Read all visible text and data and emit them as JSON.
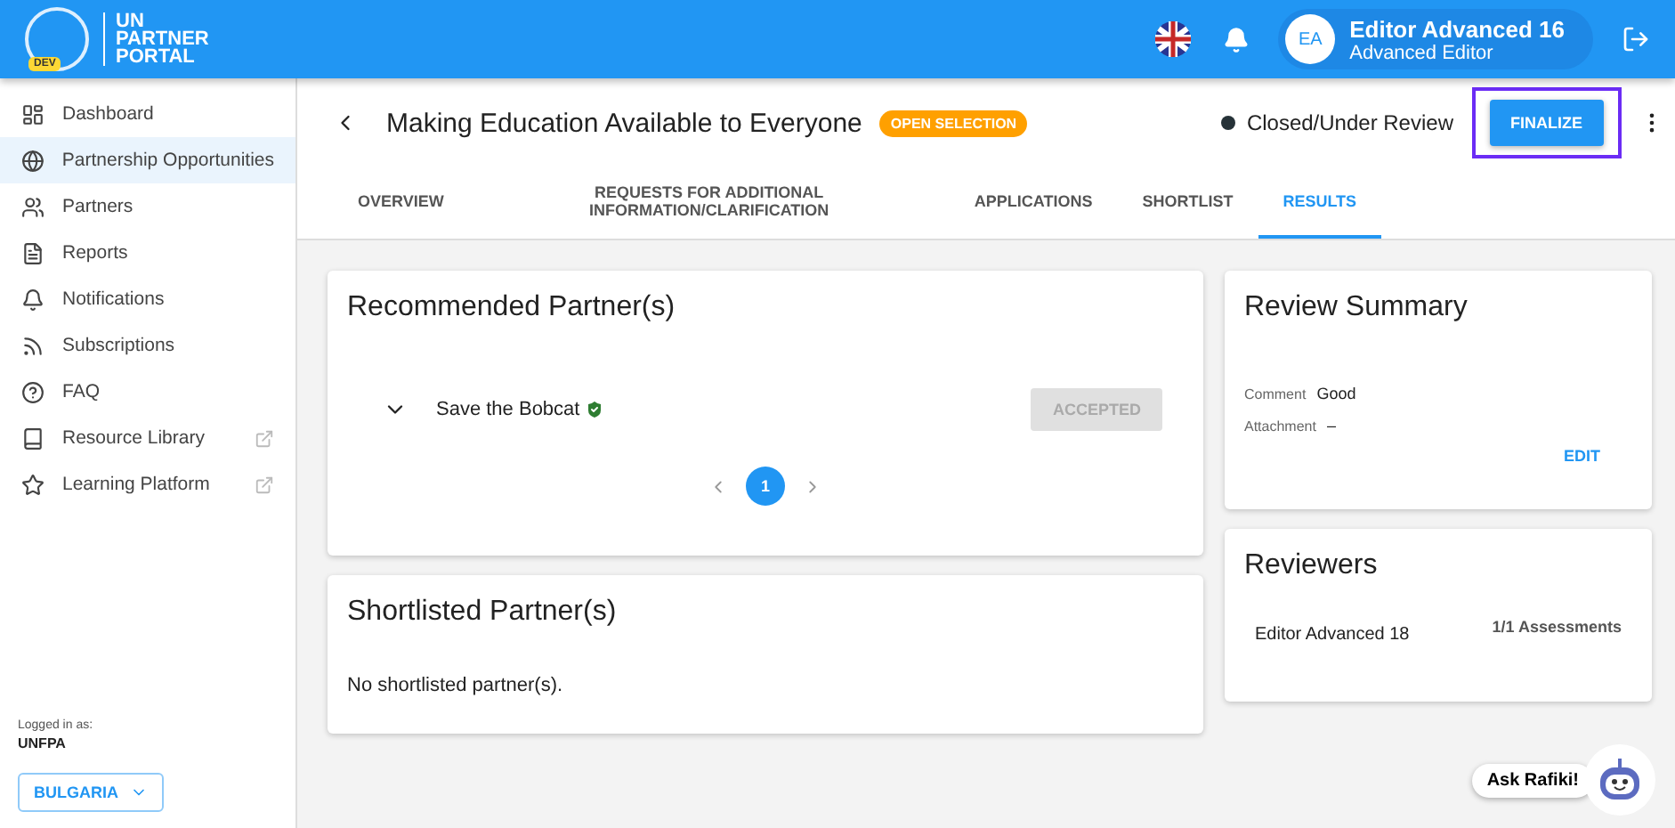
{
  "header": {
    "logo_badge": "DEV",
    "logo_text": [
      "UN",
      "PARTNER",
      "PORTAL"
    ],
    "user": {
      "initials": "EA",
      "name": "Editor Advanced 16",
      "role": "Advanced Editor"
    }
  },
  "sidebar": {
    "items": [
      {
        "label": "Dashboard",
        "external": false,
        "selected": false
      },
      {
        "label": "Partnership Opportunities",
        "external": false,
        "selected": true
      },
      {
        "label": "Partners",
        "external": false,
        "selected": false
      },
      {
        "label": "Reports",
        "external": false,
        "selected": false
      },
      {
        "label": "Notifications",
        "external": false,
        "selected": false
      },
      {
        "label": "Subscriptions",
        "external": false,
        "selected": false
      },
      {
        "label": "FAQ",
        "external": false,
        "selected": false
      },
      {
        "label": "Resource Library",
        "external": true,
        "selected": false
      },
      {
        "label": "Learning Platform",
        "external": true,
        "selected": false
      }
    ],
    "logged_in_label": "Logged in as:",
    "logged_in_value": "UNFPA",
    "country": "BULGARIA"
  },
  "page": {
    "title": "Making Education Available to Everyone",
    "badge": "OPEN SELECTION",
    "status": "Closed/Under Review",
    "primary_button": "FINALIZE",
    "highlighted": true
  },
  "tabs": [
    {
      "label": "OVERVIEW",
      "selected": false
    },
    {
      "label": "REQUESTS FOR ADDITIONAL INFORMATION/CLARIFICATION",
      "selected": false
    },
    {
      "label": "APPLICATIONS",
      "selected": false
    },
    {
      "label": "SHORTLIST",
      "selected": false
    },
    {
      "label": "RESULTS",
      "selected": true
    }
  ],
  "recommended": {
    "title": "Recommended Partner(s)",
    "partners": [
      {
        "name": "Save the Bobcat",
        "verified": true,
        "status": "ACCEPTED",
        "disabled": true
      }
    ],
    "pages": [
      {
        "label": "1",
        "selected": true
      }
    ]
  },
  "shortlisted": {
    "title": "Shortlisted Partner(s)",
    "empty_text": "No shortlisted partner(s)."
  },
  "review_summary": {
    "title": "Review Summary",
    "fields": [
      {
        "label": "Comment",
        "value": "Good"
      },
      {
        "label": "Attachment",
        "value": "–"
      }
    ],
    "action": "EDIT"
  },
  "reviewers": {
    "title": "Reviewers",
    "rows": [
      {
        "name": "Editor Advanced 18",
        "assessments": "1/1 Assessments"
      }
    ]
  },
  "chat": {
    "label": "Ask Rafiki!"
  }
}
